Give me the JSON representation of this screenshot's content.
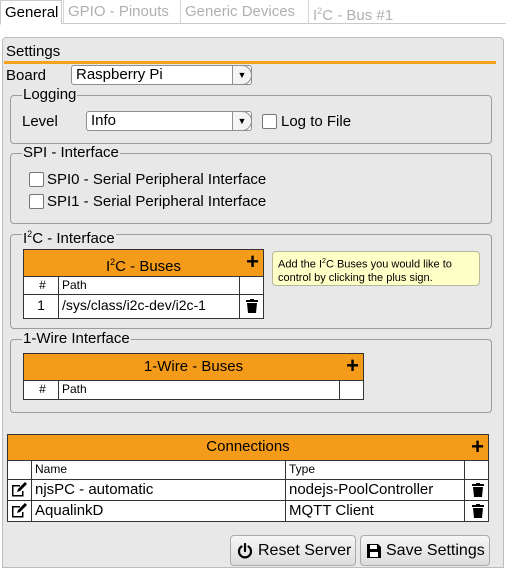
{
  "tabs": [
    {
      "label": "General",
      "active": true
    },
    {
      "label": "GPIO - Pinouts",
      "active": false
    },
    {
      "label": "Generic Devices",
      "active": false
    },
    {
      "label_pre": "I",
      "label_sup": "2",
      "label_post": "C - Bus #1",
      "active": false
    }
  ],
  "settings_title": "Settings",
  "board": {
    "label": "Board",
    "value": "Raspberry Pi"
  },
  "logging": {
    "legend": "Logging",
    "level_label": "Level",
    "level_value": "Info",
    "log_to_file": "Log to File",
    "log_to_file_checked": false
  },
  "spi": {
    "legend": "SPI - Interface",
    "options": [
      {
        "label": "SPI0 - Serial Peripheral Interface",
        "checked": false
      },
      {
        "label": "SPI1 - Serial Peripheral Interface",
        "checked": false
      }
    ]
  },
  "i2c": {
    "legend_pre": "I",
    "legend_sup": "2",
    "legend_post": "C - Interface",
    "grid_title_pre": "I",
    "grid_title_sup": "2",
    "grid_title_post": "C - Buses",
    "columns": [
      "#",
      "Path"
    ],
    "rows": [
      {
        "num": "1",
        "path": "/sys/class/i2c-dev/i2c-1"
      }
    ],
    "tooltip_pre": "Add the I",
    "tooltip_sup": "2",
    "tooltip_post": "C Buses you would like to control by clicking the plus sign."
  },
  "onewire": {
    "legend": "1-Wire Interface",
    "grid_title": "1-Wire - Buses",
    "columns": [
      "#",
      "Path"
    ],
    "rows": []
  },
  "connections": {
    "title": "Connections",
    "columns": [
      "Name",
      "Type"
    ],
    "rows": [
      {
        "name": "njsPC - automatic",
        "type": "nodejs-PoolController"
      },
      {
        "name": "AqualinkD",
        "type": "MQTT Client"
      }
    ]
  },
  "buttons": {
    "reset": "Reset Server",
    "save": "Save Settings"
  },
  "colors": {
    "accent": "#f49b1a",
    "panel": "#e8e8e8",
    "tooltip": "#ffffc8"
  }
}
